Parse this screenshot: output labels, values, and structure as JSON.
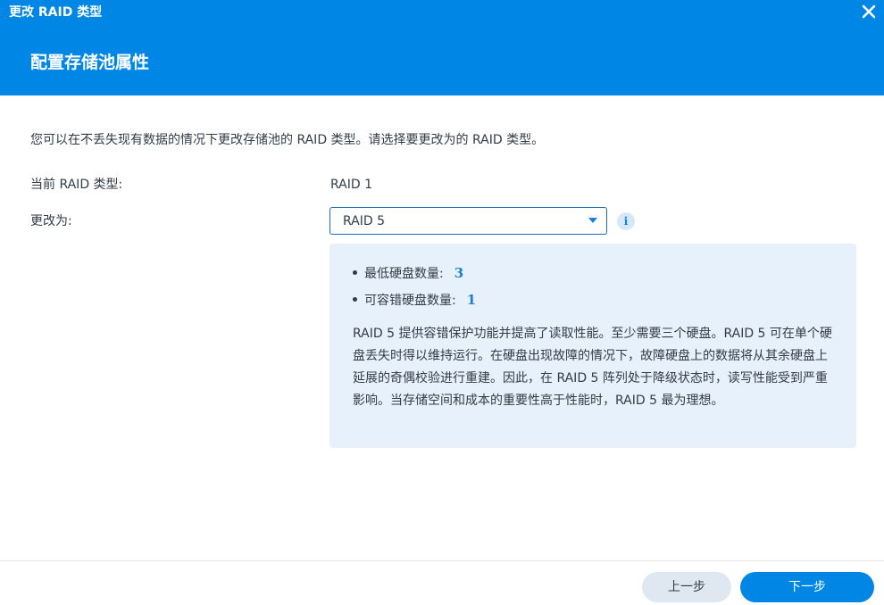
{
  "window": {
    "title": "更改 RAID 类型",
    "close_icon": "close-icon"
  },
  "header": {
    "title": "配置存储池属性"
  },
  "intro_text": "您可以在不丢失现有数据的情况下更改存储池的 RAID 类型。请选择要更改为的 RAID 类型。",
  "current": {
    "label": "当前 RAID 类型:",
    "value": "RAID 1"
  },
  "change_to": {
    "label": "更改为:",
    "selected": "RAID 5",
    "info_icon": "info-icon"
  },
  "info_panel": {
    "bullets": [
      {
        "label": "最低硬盘数量:",
        "value": "3"
      },
      {
        "label": "可容错硬盘数量:",
        "value": "1"
      }
    ],
    "description": "RAID 5 提供容错保护功能并提高了读取性能。至少需要三个硬盘。RAID 5 可在单个硬盘丢失时得以维持运行。在硬盘出现故障的情况下，故障硬盘上的数据将从其余硬盘上延展的奇偶校验进行重建。因此，在 RAID 5 阵列处于降级状态时，读写性能受到严重影响。当存储空间和成本的重要性高于性能时，RAID 5 最为理想。"
  },
  "footer": {
    "prev_label": "上一步",
    "next_label": "下一步"
  },
  "colors": {
    "accent": "#0086e5",
    "info_bg": "#e6f1fc",
    "number_blue": "#1a7fd6"
  }
}
